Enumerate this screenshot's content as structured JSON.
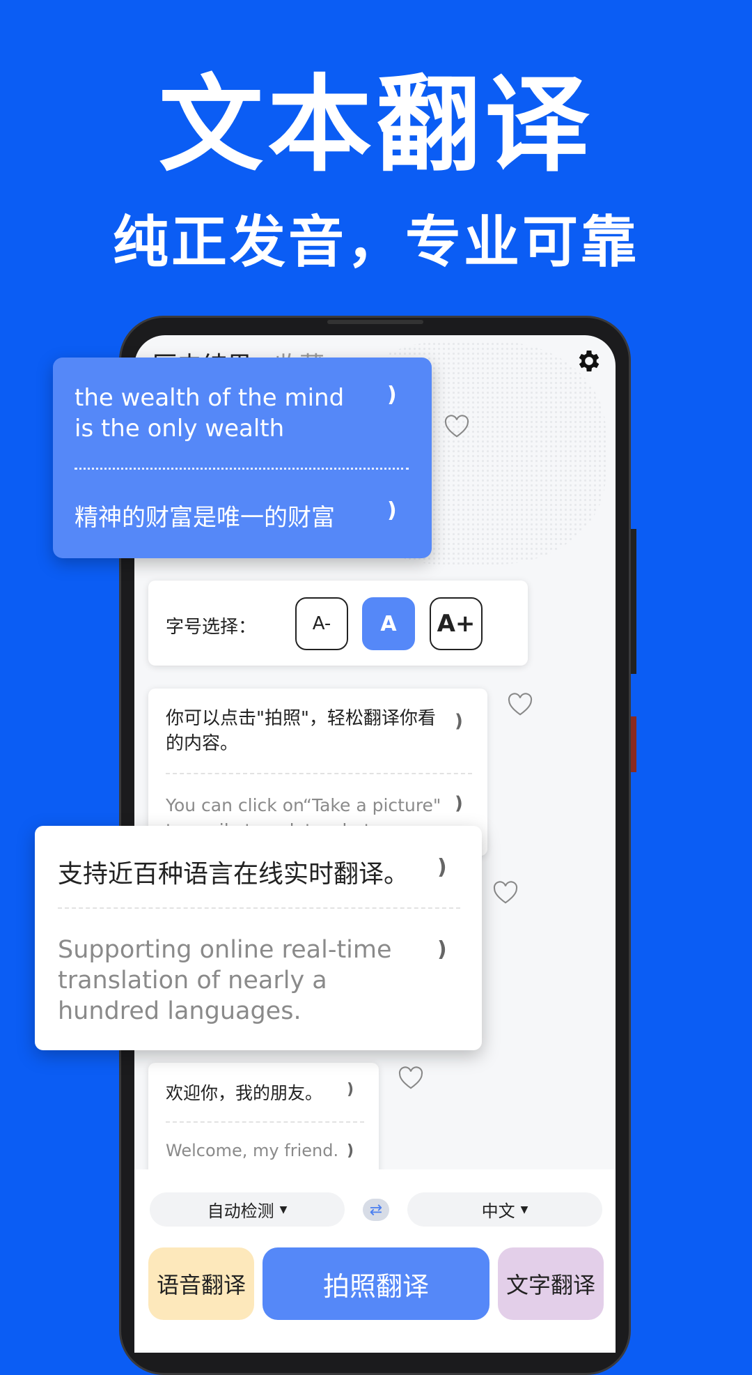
{
  "hero": {
    "title": "文本翻译",
    "subtitle": "纯正发音，专业可靠"
  },
  "tabs": [
    {
      "label": "历史结果"
    },
    {
      "label": "收藏"
    }
  ],
  "icons": {
    "settings": "gear-icon",
    "favorite": "heart-icon",
    "speaker": "speaker-icon",
    "swap": "swap-arrows-icon",
    "dropdown": "caret-down-icon"
  },
  "highlight_card": {
    "source": "the wealth of the mind is the only wealth",
    "target": "精神的财富是唯一的财富"
  },
  "font_size": {
    "label": "字号选择：",
    "options": [
      "A-",
      "A",
      "A+"
    ],
    "selected": "A"
  },
  "history": [
    {
      "source": "你可以点击\"拍照\"，轻松翻译你看的内容。",
      "target": "You can click on“Take a picture\" to easily translate what you see"
    },
    {
      "source": "支持近百种语言在线实时翻译。",
      "target": "Supporting online real-time translation of nearly a hundred languages."
    },
    {
      "source": "欢迎你，我的朋友。",
      "target": "Welcome, my friend."
    }
  ],
  "language_bar": {
    "source_lang": "自动检测",
    "target_lang": "中文"
  },
  "actions": {
    "voice": "语音翻译",
    "photo": "拍照翻译",
    "text": "文字翻译"
  },
  "colors": {
    "background": "#0b5df4",
    "accent": "#5588f8",
    "voice_btn": "#fde8bb",
    "text_btn": "#e3cfe9"
  }
}
